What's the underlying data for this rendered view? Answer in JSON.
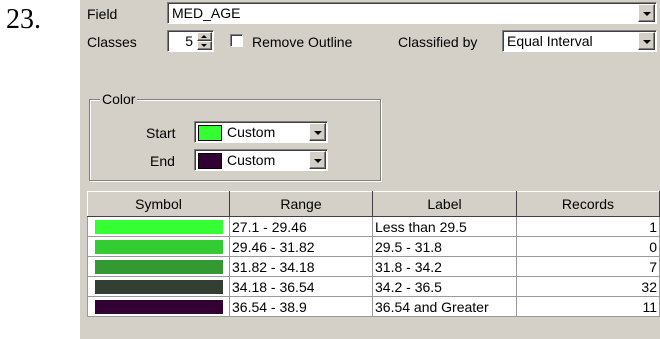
{
  "figure_number": "23.",
  "field": {
    "label": "Field",
    "value": "MED_AGE"
  },
  "classes": {
    "label": "Classes",
    "value": "5"
  },
  "remove_outline": {
    "label": "Remove Outline",
    "checked": false
  },
  "classified_by": {
    "label": "Classified by",
    "value": "Equal Interval"
  },
  "color": {
    "title": "Color",
    "start": {
      "label": "Start",
      "value": "Custom",
      "swatch": "#33ff33"
    },
    "end": {
      "label": "End",
      "value": "Custom",
      "swatch": "#330033"
    }
  },
  "table": {
    "headers": [
      "Symbol",
      "Range",
      "Label",
      "Records"
    ],
    "rows": [
      {
        "color": "#33ff33",
        "range": "27.1 - 29.46",
        "label": "Less than 29.5",
        "records": "1"
      },
      {
        "color": "#33cc33",
        "range": "29.46 - 31.82",
        "label": "29.5 - 31.8",
        "records": "0"
      },
      {
        "color": "#339933",
        "range": "31.82 - 34.18",
        "label": "31.8 - 34.2",
        "records": "7"
      },
      {
        "color": "#333f33",
        "range": "34.18 - 36.54",
        "label": "34.2 - 36.5",
        "records": "32"
      },
      {
        "color": "#330033",
        "range": "36.54 - 38.9",
        "label": "36.54 and Greater",
        "records": "11"
      }
    ]
  }
}
